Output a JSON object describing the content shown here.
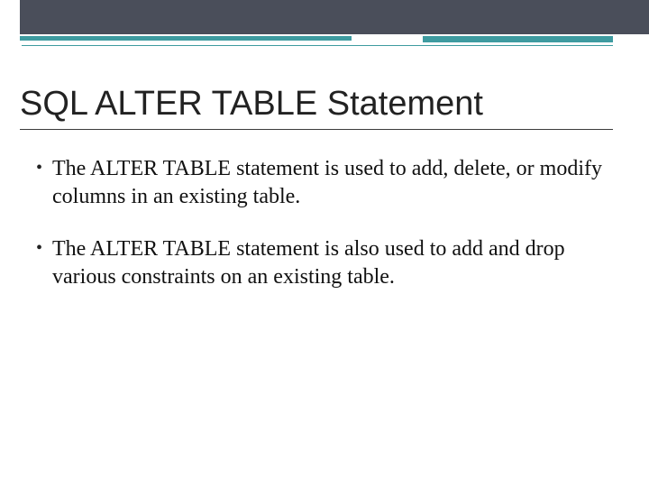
{
  "title": "SQL ALTER TABLE Statement",
  "bullets": [
    "The ALTER TABLE statement is used to add, delete, or modify columns in an existing table.",
    "The ALTER TABLE statement is also used to add and drop various constraints on an existing table."
  ],
  "bullet_glyph": "•",
  "colors": {
    "header_band": "#4a4e5a",
    "accent": "#3e9ba0"
  }
}
